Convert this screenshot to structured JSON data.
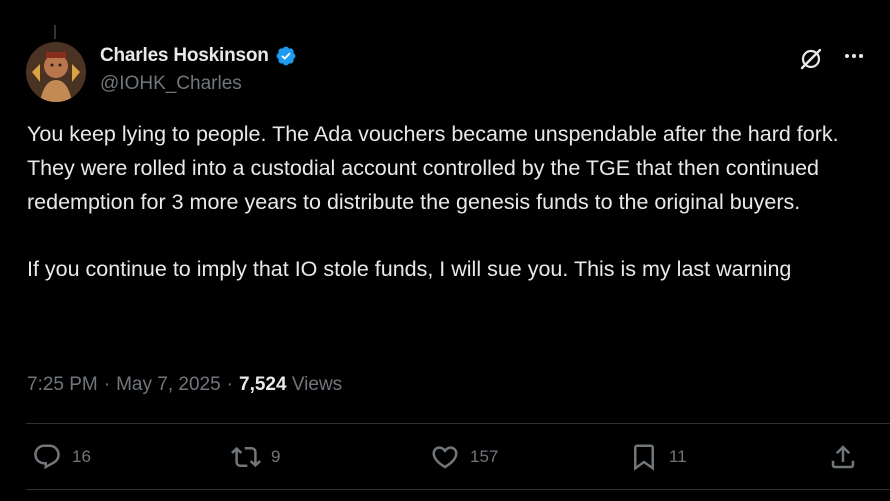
{
  "author": {
    "name": "Charles Hoskinson",
    "handle": "@IOHK_Charles",
    "verified": true
  },
  "tweet": {
    "paragraphs": [
      "You keep lying to people. The Ada vouchers became unspendable after the hard fork. They were rolled into a custodial account controlled by the TGE that then continued redemption for 3 more years to distribute the genesis funds to the original buyers.",
      "If you continue to imply that IO stole funds, I will sue you. This is my last warning"
    ]
  },
  "meta": {
    "time": "7:25 PM",
    "separator": "·",
    "date": "May 7, 2025",
    "views_count": "7,524",
    "views_label": "Views"
  },
  "actions": {
    "replies": "16",
    "reposts": "9",
    "likes": "157",
    "bookmarks": "11"
  },
  "colors": {
    "background": "#000000",
    "text": "#e7e9ea",
    "secondary": "#71767b",
    "verified": "#1d9bf0",
    "divider": "#2f3336"
  },
  "icons": [
    "grok-icon",
    "more-icon",
    "verified-badge-icon",
    "reply-icon",
    "repost-icon",
    "like-icon",
    "bookmark-icon",
    "share-icon"
  ]
}
